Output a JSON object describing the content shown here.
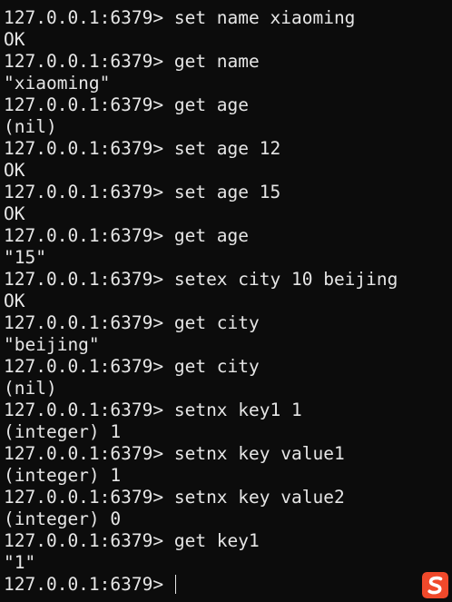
{
  "terminal": {
    "lines": [
      {
        "kind": "input",
        "prompt": "127.0.0.1:6379> ",
        "text": "set name xiaoming"
      },
      {
        "kind": "output",
        "text": "OK"
      },
      {
        "kind": "input",
        "prompt": "127.0.0.1:6379> ",
        "text": "get name"
      },
      {
        "kind": "output",
        "text": "\"xiaoming\""
      },
      {
        "kind": "input",
        "prompt": "127.0.0.1:6379> ",
        "text": "get age"
      },
      {
        "kind": "output",
        "text": "(nil)"
      },
      {
        "kind": "input",
        "prompt": "127.0.0.1:6379> ",
        "text": "set age 12"
      },
      {
        "kind": "output",
        "text": "OK"
      },
      {
        "kind": "input",
        "prompt": "127.0.0.1:6379> ",
        "text": "set age 15"
      },
      {
        "kind": "output",
        "text": "OK"
      },
      {
        "kind": "input",
        "prompt": "127.0.0.1:6379> ",
        "text": "get age"
      },
      {
        "kind": "output",
        "text": "\"15\""
      },
      {
        "kind": "input",
        "prompt": "127.0.0.1:6379> ",
        "text": "setex city 10 beijing"
      },
      {
        "kind": "output",
        "text": "OK"
      },
      {
        "kind": "input",
        "prompt": "127.0.0.1:6379> ",
        "text": "get city"
      },
      {
        "kind": "output",
        "text": "\"beijing\""
      },
      {
        "kind": "input",
        "prompt": "127.0.0.1:6379> ",
        "text": "get city"
      },
      {
        "kind": "output",
        "text": "(nil)"
      },
      {
        "kind": "input",
        "prompt": "127.0.0.1:6379> ",
        "text": "setnx key1 1"
      },
      {
        "kind": "output",
        "text": "(integer) 1"
      },
      {
        "kind": "input",
        "prompt": "127.0.0.1:6379> ",
        "text": "setnx key value1"
      },
      {
        "kind": "output",
        "text": "(integer) 1"
      },
      {
        "kind": "input",
        "prompt": "127.0.0.1:6379> ",
        "text": "setnx key value2"
      },
      {
        "kind": "output",
        "text": "(integer) 0"
      },
      {
        "kind": "input",
        "prompt": "127.0.0.1:6379> ",
        "text": "get key1"
      },
      {
        "kind": "output",
        "text": "\"1\""
      }
    ],
    "current_prompt": "127.0.0.1:6379> ",
    "current_input": ""
  },
  "ime_badge": {
    "icon": "sogou-ime-icon",
    "glyph": "S",
    "color": "#f0492b"
  },
  "colors": {
    "background": "#0c0c0c",
    "foreground": "#e6e6e6"
  }
}
